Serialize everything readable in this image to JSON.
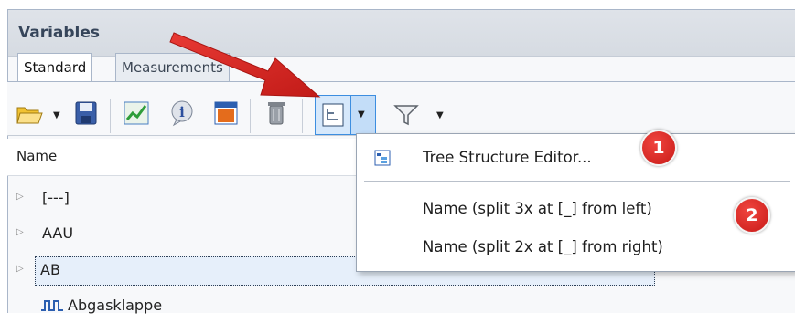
{
  "panel": {
    "title": "Variables"
  },
  "tabs": [
    {
      "label": "Standard",
      "active": true
    },
    {
      "label": "Measurements",
      "active": false
    }
  ],
  "toolbar": {
    "icons": [
      "open-folder-icon",
      "save-icon",
      "chart-icon",
      "info-icon",
      "table-icon",
      "delete-icon",
      "tree-structure-icon",
      "filter-icon"
    ]
  },
  "column_header": "Name",
  "tree_rows": [
    {
      "label": "[---]",
      "expandable": true
    },
    {
      "label": "AAU",
      "expandable": true
    },
    {
      "label": "AB",
      "expandable": true,
      "selected": true
    },
    {
      "label": "Abgasklappe",
      "icon": "signal-icon"
    }
  ],
  "menu": {
    "items": [
      {
        "label": "Tree Structure Editor...",
        "icon": "tree-editor-icon"
      },
      {
        "label": "Name (split 3x at [_] from  left)"
      },
      {
        "label": "Name (split 2x at [_] from  right)"
      }
    ]
  },
  "callouts": [
    "1",
    "2"
  ],
  "colors": {
    "accent": "#3d8ee0",
    "callout": "#d42b27",
    "panel_title": "#36455a"
  }
}
